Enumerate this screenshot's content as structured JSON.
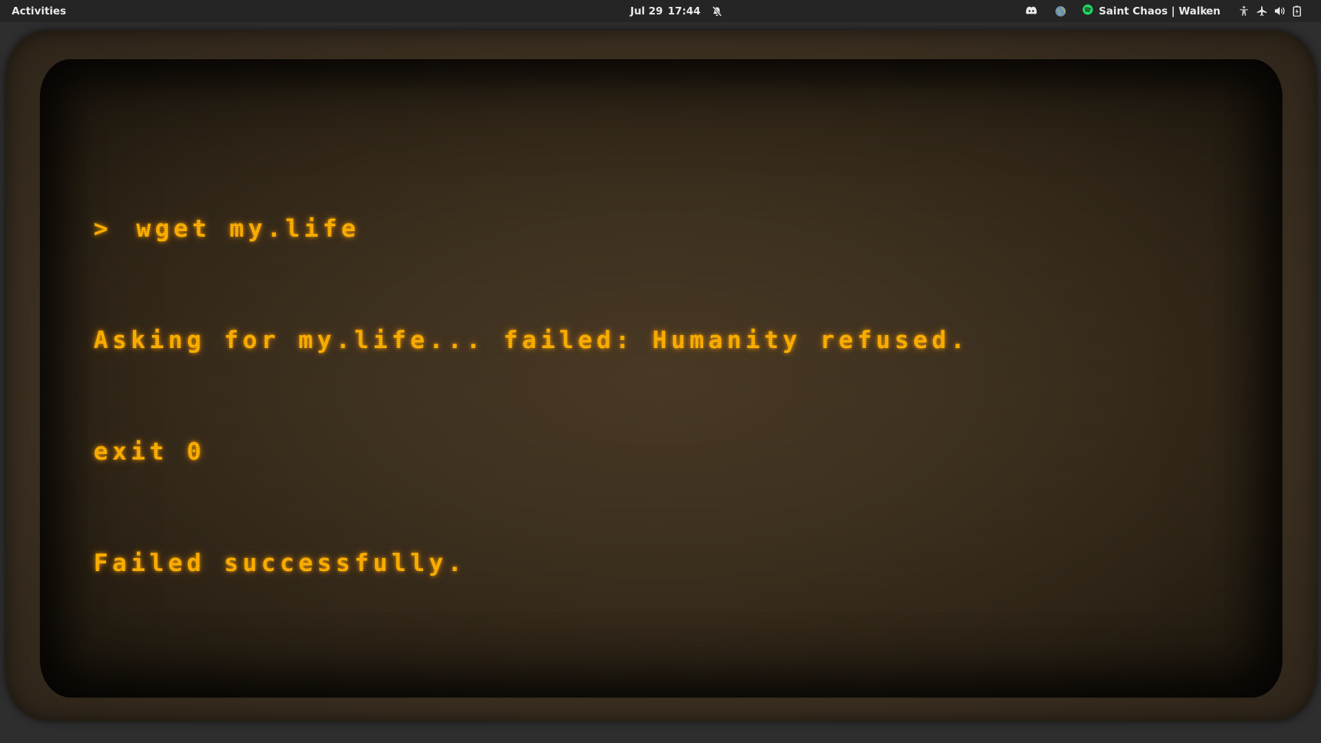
{
  "topbar": {
    "activities_label": "Activities",
    "date": "Jul 29",
    "time": "17:44",
    "media_label": "Saint Chaos | Walk",
    "language": "en",
    "icons": {
      "notifications": "bell-off-icon",
      "discord": "discord-icon",
      "browser": "globe-icon",
      "spotify": "spotify-icon",
      "accessibility": "accessibility-icon",
      "airplane": "airplane-mode-icon",
      "volume": "volume-icon",
      "battery": "battery-icon"
    }
  },
  "terminal": {
    "prompt_symbol": ">",
    "command": "wget my.life",
    "output": [
      "Asking for my.life... failed: Humanity refused.",
      "exit 0",
      "Failed successfully."
    ],
    "text_color": "#ffb000",
    "background_color": "#3a2e1f"
  }
}
